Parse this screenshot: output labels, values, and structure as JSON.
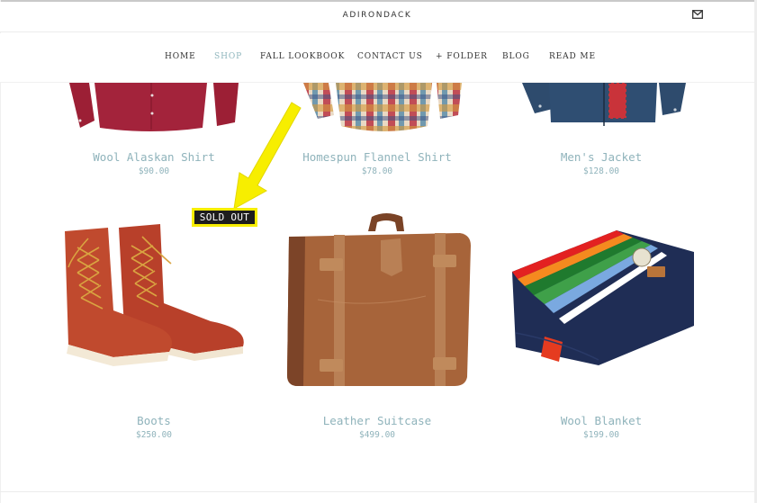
{
  "site": {
    "title": "ADIRONDACK",
    "mail_icon": "mail-icon"
  },
  "nav": {
    "items": [
      {
        "label": "HOME",
        "active": false
      },
      {
        "label": "SHOP",
        "active": true
      },
      {
        "label": "FALL LOOKBOOK",
        "active": false
      },
      {
        "label": "CONTACT US",
        "active": false
      },
      {
        "label": "+ FOLDER",
        "active": false
      },
      {
        "label": "BLOG",
        "active": false
      },
      {
        "label": "READ ME",
        "active": false
      }
    ]
  },
  "products": [
    {
      "name": "Wool Alaskan Shirt",
      "price": "$90.00",
      "image": "red-wool-shirt"
    },
    {
      "name": "Homespun Flannel Shirt",
      "price": "$78.00",
      "image": "plaid-flannel-shirt"
    },
    {
      "name": "Men's Jacket",
      "price": "$128.00",
      "image": "navy-jacket"
    },
    {
      "name": "Boots",
      "price": "$250.00",
      "image": "red-leather-boots",
      "badge": "SOLD OUT"
    },
    {
      "name": "Leather Suitcase",
      "price": "$499.00",
      "image": "leather-suitcase"
    },
    {
      "name": "Wool Blanket",
      "price": "$199.00",
      "image": "striped-wool-blanket"
    }
  ],
  "annotation": {
    "label": "SOLD OUT",
    "highlight_color": "#f7ee00"
  },
  "colors": {
    "accent": "#8fb6bd",
    "text": "#333333"
  }
}
